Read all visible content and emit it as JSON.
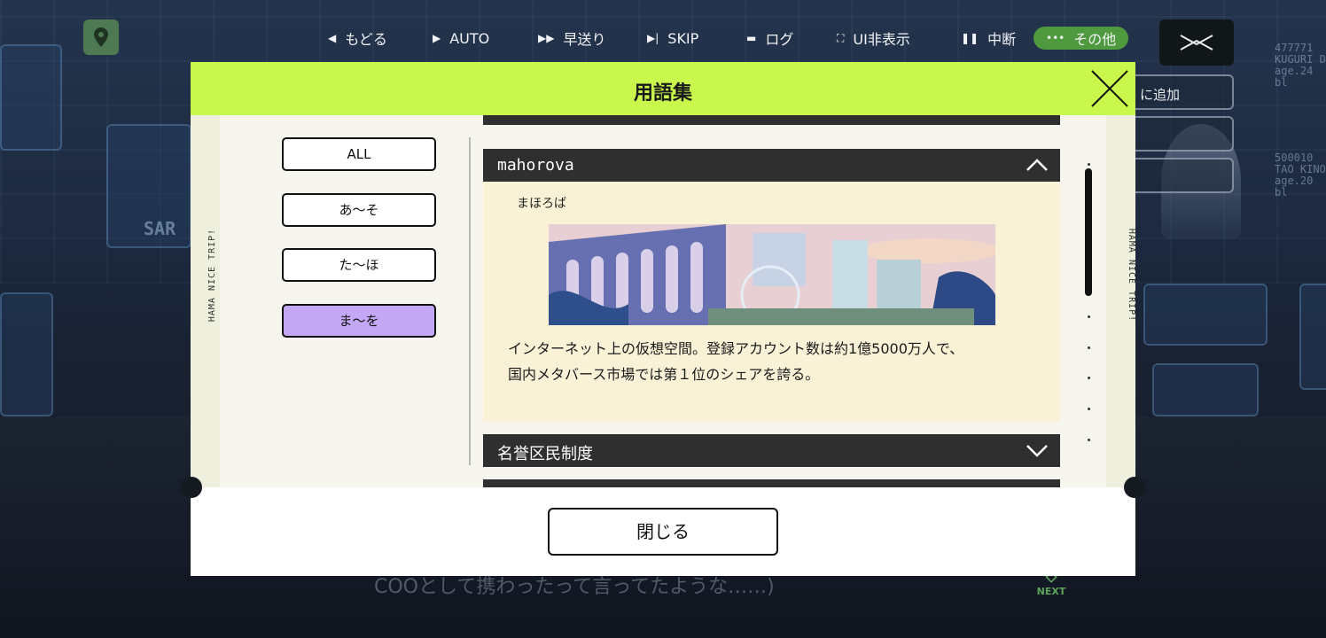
{
  "top_menu": {
    "back_label": "もどる",
    "auto_label": "AUTO",
    "fast_forward_label": "早送り",
    "skip_label": "SKIP",
    "log_label": "ログ",
    "hide_ui_label": "UI非表示",
    "pause_label": "中断",
    "other_label": "その他"
  },
  "scene": {
    "right_buttons": [
      "に追加",
      "",
      ""
    ],
    "char1_label": [
      "477771",
      "KUGURI D",
      "age.24 bl"
    ],
    "char2_label": [
      "500010",
      "TAO KINO",
      "age.20 bl"
    ],
    "dialogue_text": "COOとして携わったって言ってたような……)",
    "next_label": "NEXT",
    "sign_text": "SAR"
  },
  "modal": {
    "title": "用語集",
    "side_text": "HAMA NICE TRIP!",
    "filters": [
      "ALL",
      "あ～そ",
      "た～ほ",
      "ま～を"
    ],
    "active_filter_index": 3,
    "entries": [
      {
        "term": "mahorova",
        "expanded": true,
        "reading": "まほろば",
        "description_lines": [
          "インターネット上の仮想空間。登録アカウント数は約1億5000万人で、",
          "国内メタバース市場では第１位のシェアを誇る。"
        ]
      },
      {
        "term": "名誉区民制度",
        "expanded": false
      }
    ],
    "close_button_label": "閉じる"
  },
  "colors": {
    "header_bg": "#c9f74c",
    "active_filter_bg": "#c5a8f5",
    "entry_bar_bg": "#2f2f30",
    "entry_body_bg": "#f9f2d7",
    "other_menu_bg": "#4f9a3e"
  }
}
